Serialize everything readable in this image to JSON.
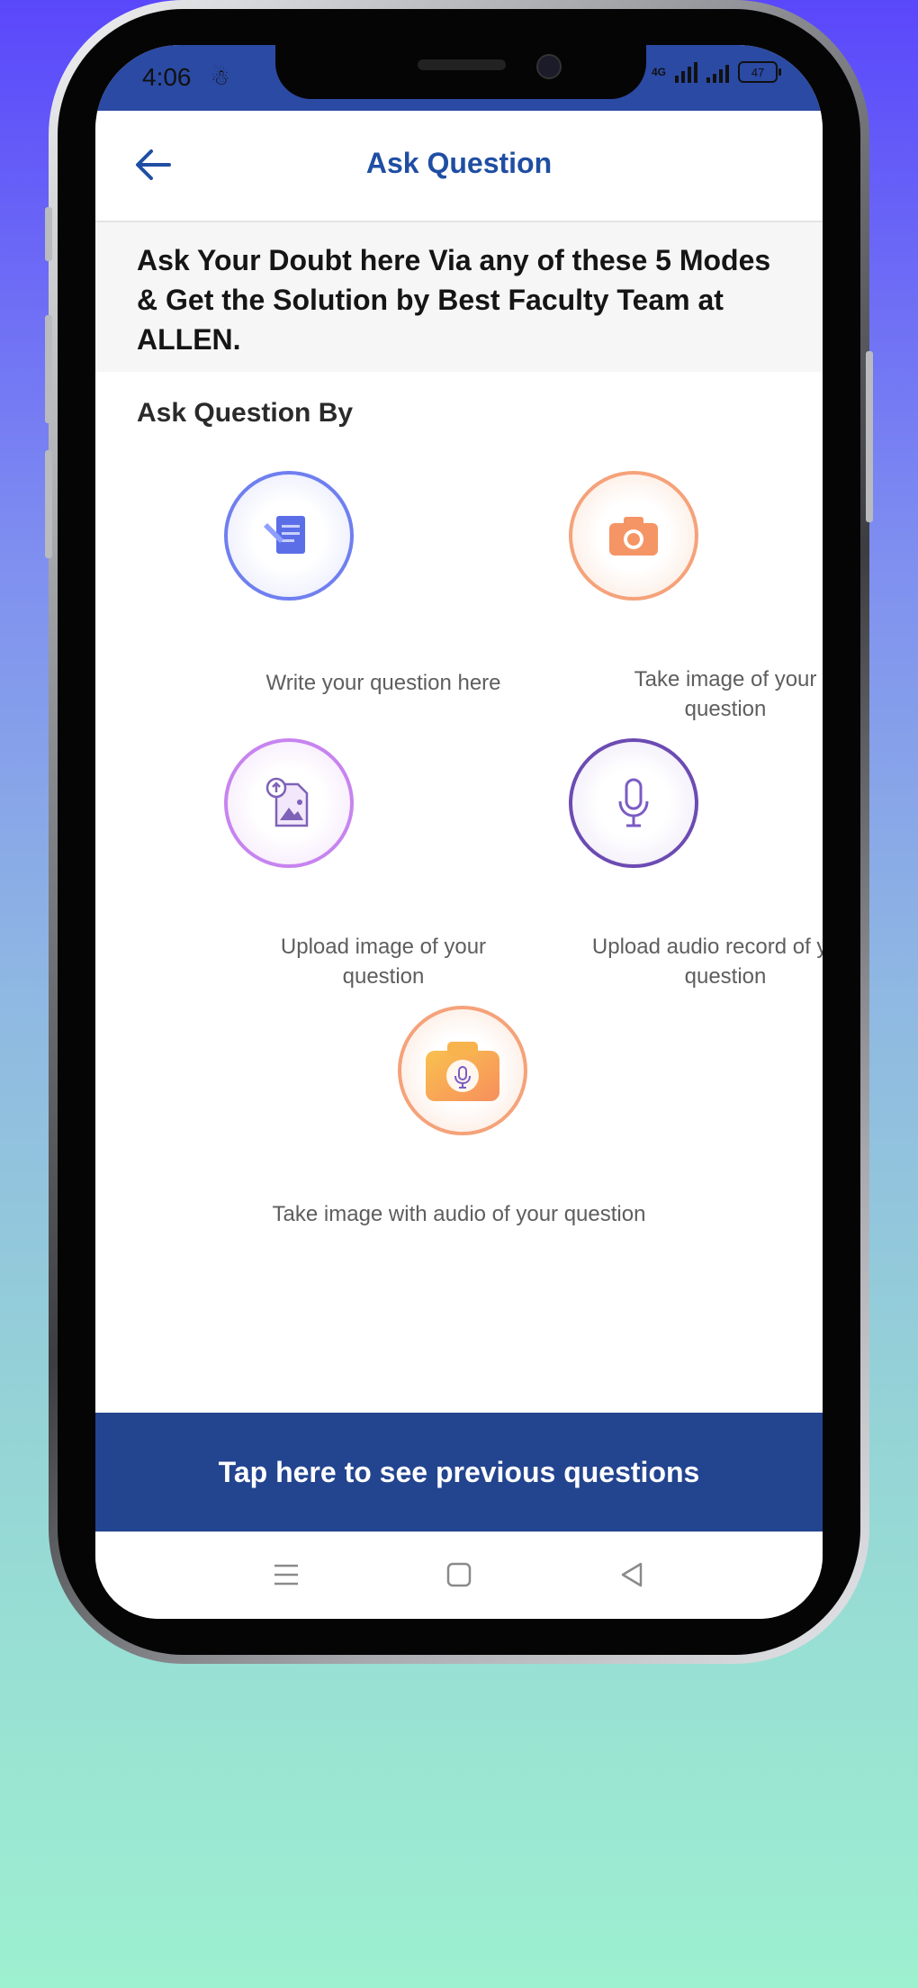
{
  "status_bar": {
    "time": "4:06",
    "network": "4G",
    "battery": "47"
  },
  "header": {
    "title": "Ask Question"
  },
  "intro": {
    "text": "Ask Your Doubt here Via any of these 5 Modes & Get the Solution by Best Faculty Team at ALLEN."
  },
  "section": {
    "label": "Ask Question By"
  },
  "options": [
    {
      "label": "Write your question here",
      "icon": "write-question-icon",
      "color": "#6f7ff0"
    },
    {
      "label": "Take image of your question",
      "icon": "camera-icon",
      "color": "#f5a27a"
    },
    {
      "label": "Upload image of your question",
      "icon": "upload-image-icon",
      "color": "#c784ef"
    },
    {
      "label": "Upload audio record of your question",
      "icon": "microphone-icon",
      "color": "#6c4bb3"
    },
    {
      "label": "Take image with audio of your question",
      "icon": "camera-mic-icon",
      "color": "#f5a27a"
    }
  ],
  "footer": {
    "previous_questions_label": "Tap here to see previous questions"
  },
  "colors": {
    "primary": "#23448f",
    "title_blue": "#1f4ea3"
  }
}
